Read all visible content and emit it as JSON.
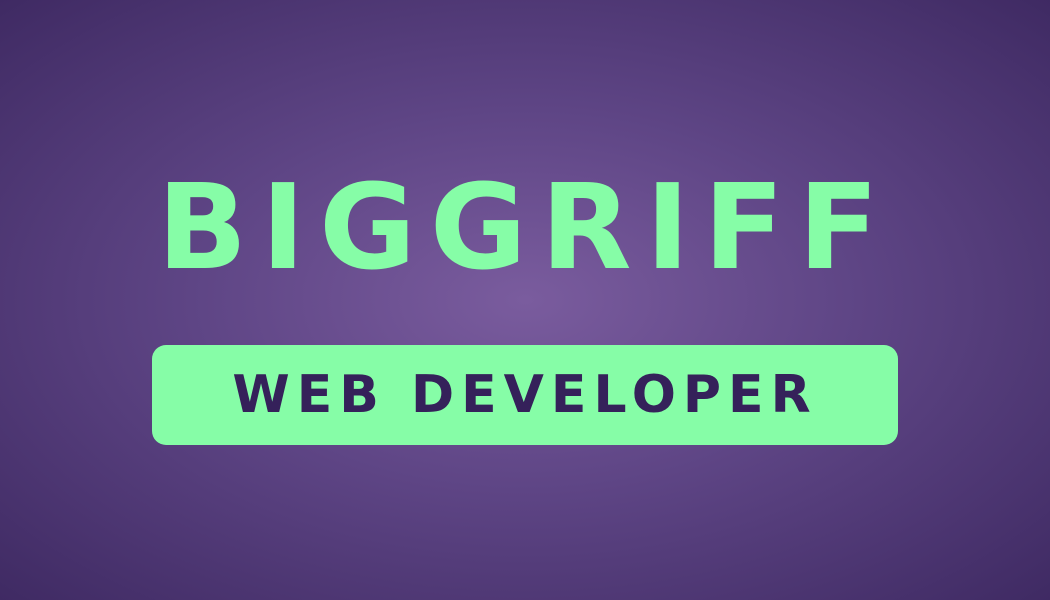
{
  "logo": {
    "name": "BIGGRIFF",
    "role": "WEB DEVELOPER"
  },
  "colors": {
    "background_center": "#7a5c9e",
    "background_edge": "#3f2a63",
    "accent": "#86fda7",
    "role_text": "#35215a"
  }
}
